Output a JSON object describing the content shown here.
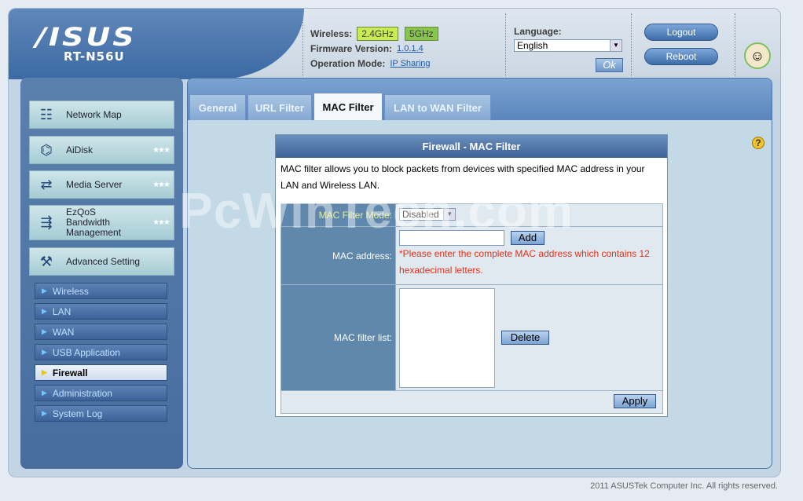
{
  "header": {
    "brand": "/ISUS",
    "model": "RT-N56U",
    "wireless_label": "Wireless:",
    "band_24": "2.4GHz",
    "band_5": "5GHz",
    "firmware_label": "Firmware Version:",
    "firmware_value": "1.0.1.4",
    "opmode_label": "Operation Mode:",
    "opmode_value": "IP Sharing",
    "language_label": "Language:",
    "language_value": "English",
    "ok_label": "Ok",
    "logout_label": "Logout",
    "reboot_label": "Reboot"
  },
  "sidebar": {
    "items": [
      {
        "label": "Network Map",
        "icon": "network-map-icon"
      },
      {
        "label": "AiDisk",
        "icon": "aidisk-icon"
      },
      {
        "label": "Media Server",
        "icon": "media-server-icon"
      },
      {
        "label": "EzQoS Bandwidth Management",
        "icon": "ezqos-icon"
      },
      {
        "label": "Advanced Setting",
        "icon": "advanced-setting-icon"
      }
    ],
    "sub": [
      "Wireless",
      "LAN",
      "WAN",
      "USB Application",
      "Firewall",
      "Administration",
      "System Log"
    ],
    "active_sub": "Firewall"
  },
  "tabs": [
    "General",
    "URL Filter",
    "MAC Filter",
    "LAN to WAN Filter"
  ],
  "active_tab": "MAC Filter",
  "panel": {
    "title": "Firewall - MAC Filter",
    "description": "MAC filter allows you to block packets from devices with specified MAC address in your LAN and Wireless LAN.",
    "mode_label": "MAC Filter Mode:",
    "mode_value": "Disabled",
    "mac_label": "MAC address:",
    "mac_value": "",
    "add_label": "Add",
    "warning": "*Please enter the complete MAC address which contains 12 hexadecimal letters.",
    "list_label": "MAC filter list:",
    "delete_label": "Delete",
    "apply_label": "Apply"
  },
  "watermark": "PcWinTech.com",
  "footer": "2011 ASUSTek Computer Inc. All rights reserved.",
  "colors": {
    "accent": "#3d6aa4",
    "band_24": "#c9ec52",
    "band_5": "#88c54d",
    "warning": "#e8301a"
  }
}
